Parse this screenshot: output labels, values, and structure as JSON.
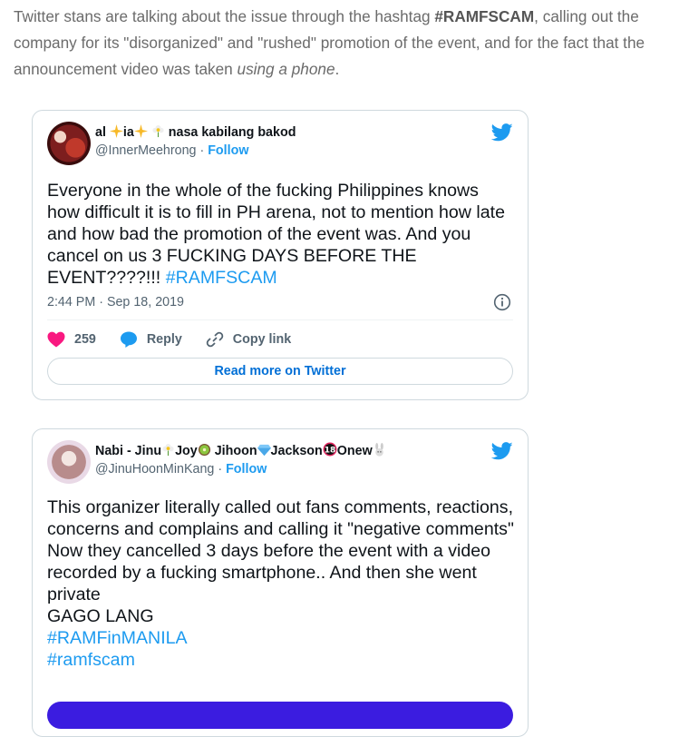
{
  "intro": {
    "part1": "Twitter stans are talking about the issue through the hashtag ",
    "hashtag": "#RAMFSCAM",
    "part2": ", calling out the company for its \"disorganized\" and \"rushed\" promotion of the event, and for the fact that the announcement video was taken ",
    "italic": "using a phone",
    "part3": "."
  },
  "tweets": [
    {
      "name_a": "al ",
      "name_b": "ia",
      "name_c": " nasa kabilang bakod",
      "handle": "@InnerMeehrong",
      "separator": " · ",
      "follow": "Follow",
      "body": "Everyone in the whole of the fucking Philippines knows how difficult it is to fill in PH arena, not to mention how late and how bad the promotion of the event was. And you cancel on us 3 FUCKING DAYS BEFORE THE EVENT????!!! ",
      "hashtag": "#RAMFSCAM",
      "timestamp": "2:44 PM · Sep 18, 2019",
      "likes": "259",
      "reply_label": "Reply",
      "copy_label": "Copy link",
      "read_more": "Read more on Twitter"
    },
    {
      "name_a": "Nabi - Jinu",
      "name_b": "Joy",
      "name_c": " Jihoon",
      "name_d": "Jackson",
      "name_e": "Onew",
      "handle": "@JinuHoonMinKang",
      "separator": " · ",
      "follow": "Follow",
      "line1": "This organizer literally called out fans comments, reactions, concerns and complains and calling it \"negative comments\"",
      "line2": "Now they cancelled 3 days before the event with a video recorded by a fucking smartphone.. And then she went private",
      "line3": "GAGO LANG",
      "hashtag1": "#RAMFinMANILA",
      "hashtag2": "#ramfscam"
    }
  ],
  "colors": {
    "twitter_blue": "#1d9bf0",
    "heart_red": "#f91880",
    "link_blue": "#006fd6",
    "purple_bar": "#3b1ce0"
  },
  "icons": [
    "twitter-bird-icon",
    "info-icon",
    "heart-icon",
    "reply-icon",
    "link-icon",
    "sparkle-icon",
    "flower-icon",
    "kiwi-icon",
    "diamond-icon",
    "age-18-icon",
    "bunny-icon"
  ]
}
